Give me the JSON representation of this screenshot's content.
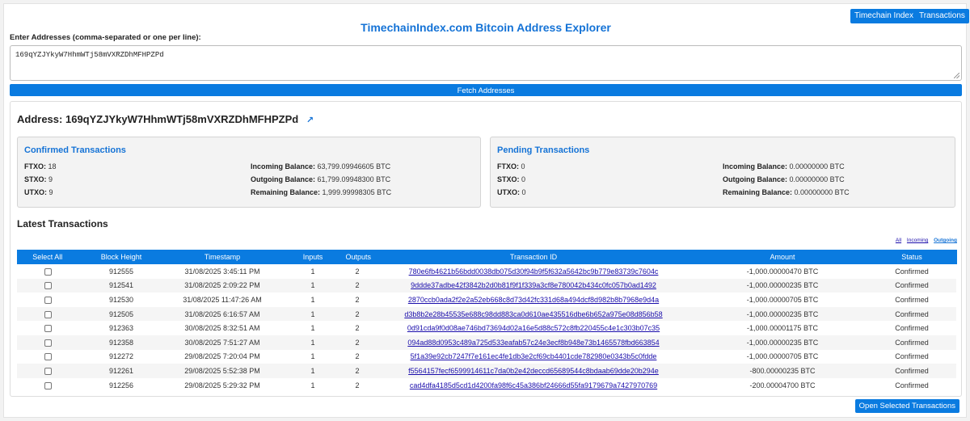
{
  "header": {
    "title": "TimechainIndex.com Bitcoin Address Explorer",
    "nav_timechain_label": "Timechain Index",
    "nav_transactions_label": "Transactions"
  },
  "input": {
    "label": "Enter Addresses (comma-separated or one per line):",
    "value": "169qYZJYkyW7HhmWTj58mVXRZDhMFHPZPd"
  },
  "fetch_label": "Fetch Addresses",
  "address": {
    "label": "Address:",
    "value": "169qYZJYkyW7HhmWTj58mVXRZDhMFHPZPd",
    "link_icon": "external-link-icon"
  },
  "confirmed": {
    "title": "Confirmed Transactions",
    "ftxo_label": "FTXO:",
    "ftxo": "18",
    "stxo_label": "STXO:",
    "stxo": "9",
    "utxo_label": "UTXO:",
    "utxo": "9",
    "incoming_label": "Incoming Balance:",
    "incoming": "63,799.09946605 BTC",
    "outgoing_label": "Outgoing Balance:",
    "outgoing": "61,799.09948300 BTC",
    "remaining_label": "Remaining Balance:",
    "remaining": "1,999.99998305 BTC"
  },
  "pending": {
    "title": "Pending Transactions",
    "ftxo_label": "FTXO:",
    "ftxo": "0",
    "stxo_label": "STXO:",
    "stxo": "0",
    "utxo_label": "UTXO:",
    "utxo": "0",
    "incoming_label": "Incoming Balance:",
    "incoming": "0.00000000 BTC",
    "outgoing_label": "Outgoing Balance:",
    "outgoing": "0.00000000 BTC",
    "remaining_label": "Remaining Balance:",
    "remaining": "0.00000000 BTC"
  },
  "latest_title": "Latest Transactions",
  "filters": {
    "all": "All",
    "incoming": "Incoming",
    "outgoing": "Outgoing",
    "active": "outgoing"
  },
  "table": {
    "headers": [
      "Select All",
      "Block Height",
      "Timestamp",
      "Inputs",
      "Outputs",
      "Transaction ID",
      "Amount",
      "Status"
    ],
    "rows": [
      {
        "block": "912555",
        "time": "31/08/2025 3:45:11 PM",
        "inputs": "1",
        "outputs": "2",
        "txid": "780e6fb4621b56bdd0038db075d30f94b9f5f632a5642bc9b779e83739c7604c",
        "amount": "-1,000.00000470 BTC",
        "status": "Confirmed"
      },
      {
        "block": "912541",
        "time": "31/08/2025 2:09:22 PM",
        "inputs": "1",
        "outputs": "2",
        "txid": "9ddde37adbe42f3842b2d0b81f9f1f339a3cf8e780042b434c0fc057b0ad1492",
        "amount": "-1,000.00000235 BTC",
        "status": "Confirmed"
      },
      {
        "block": "912530",
        "time": "31/08/2025 11:47:26 AM",
        "inputs": "1",
        "outputs": "2",
        "txid": "2870ccb0ada2f2e2a52eb668c8d73d42fc331d68a494dcf8d982b8b7968e9d4a",
        "amount": "-1,000.00000705 BTC",
        "status": "Confirmed"
      },
      {
        "block": "912505",
        "time": "31/08/2025 6:16:57 AM",
        "inputs": "1",
        "outputs": "2",
        "txid": "d3b8b2e28b45535e688c98dd883ca0d610ae435516dbe6b652a975e08d856b58",
        "amount": "-1,000.00000235 BTC",
        "status": "Confirmed"
      },
      {
        "block": "912363",
        "time": "30/08/2025 8:32:51 AM",
        "inputs": "1",
        "outputs": "2",
        "txid": "0d91cda9f0d08ae746bd73694d02a16e5d88c572c8fb220455c4e1c303b07c35",
        "amount": "-1,000.00001175 BTC",
        "status": "Confirmed"
      },
      {
        "block": "912358",
        "time": "30/08/2025 7:51:27 AM",
        "inputs": "1",
        "outputs": "2",
        "txid": "094ad88d0953c489a725d533eafab57c24e3ecf8b948e73b1465578fbd663854",
        "amount": "-1,000.00000235 BTC",
        "status": "Confirmed"
      },
      {
        "block": "912272",
        "time": "29/08/2025 7:20:04 PM",
        "inputs": "1",
        "outputs": "2",
        "txid": "5f1a39e92cb7247f7e161ec4fe1db3e2cf69cb4401cde782980e0343b5c0fdde",
        "amount": "-1,000.00000705 BTC",
        "status": "Confirmed"
      },
      {
        "block": "912261",
        "time": "29/08/2025 5:52:38 PM",
        "inputs": "1",
        "outputs": "2",
        "txid": "f5564157fecf6599914611c7da0b2e42deccd65689544c8bdaab69dde20b294e",
        "amount": "-800.00000235 BTC",
        "status": "Confirmed"
      },
      {
        "block": "912256",
        "time": "29/08/2025 5:29:32 PM",
        "inputs": "1",
        "outputs": "2",
        "txid": "cad4dfa4185d5cd1d4200fa98f6c45a386bf24666d55fa9179679a7427970769",
        "amount": "-200.00004700 BTC",
        "status": "Confirmed"
      }
    ]
  },
  "open_selected_label": "Open Selected Transactions",
  "colors": {
    "accent": "#0a7be0",
    "title": "#1573d6",
    "link": "#1a0dab"
  }
}
